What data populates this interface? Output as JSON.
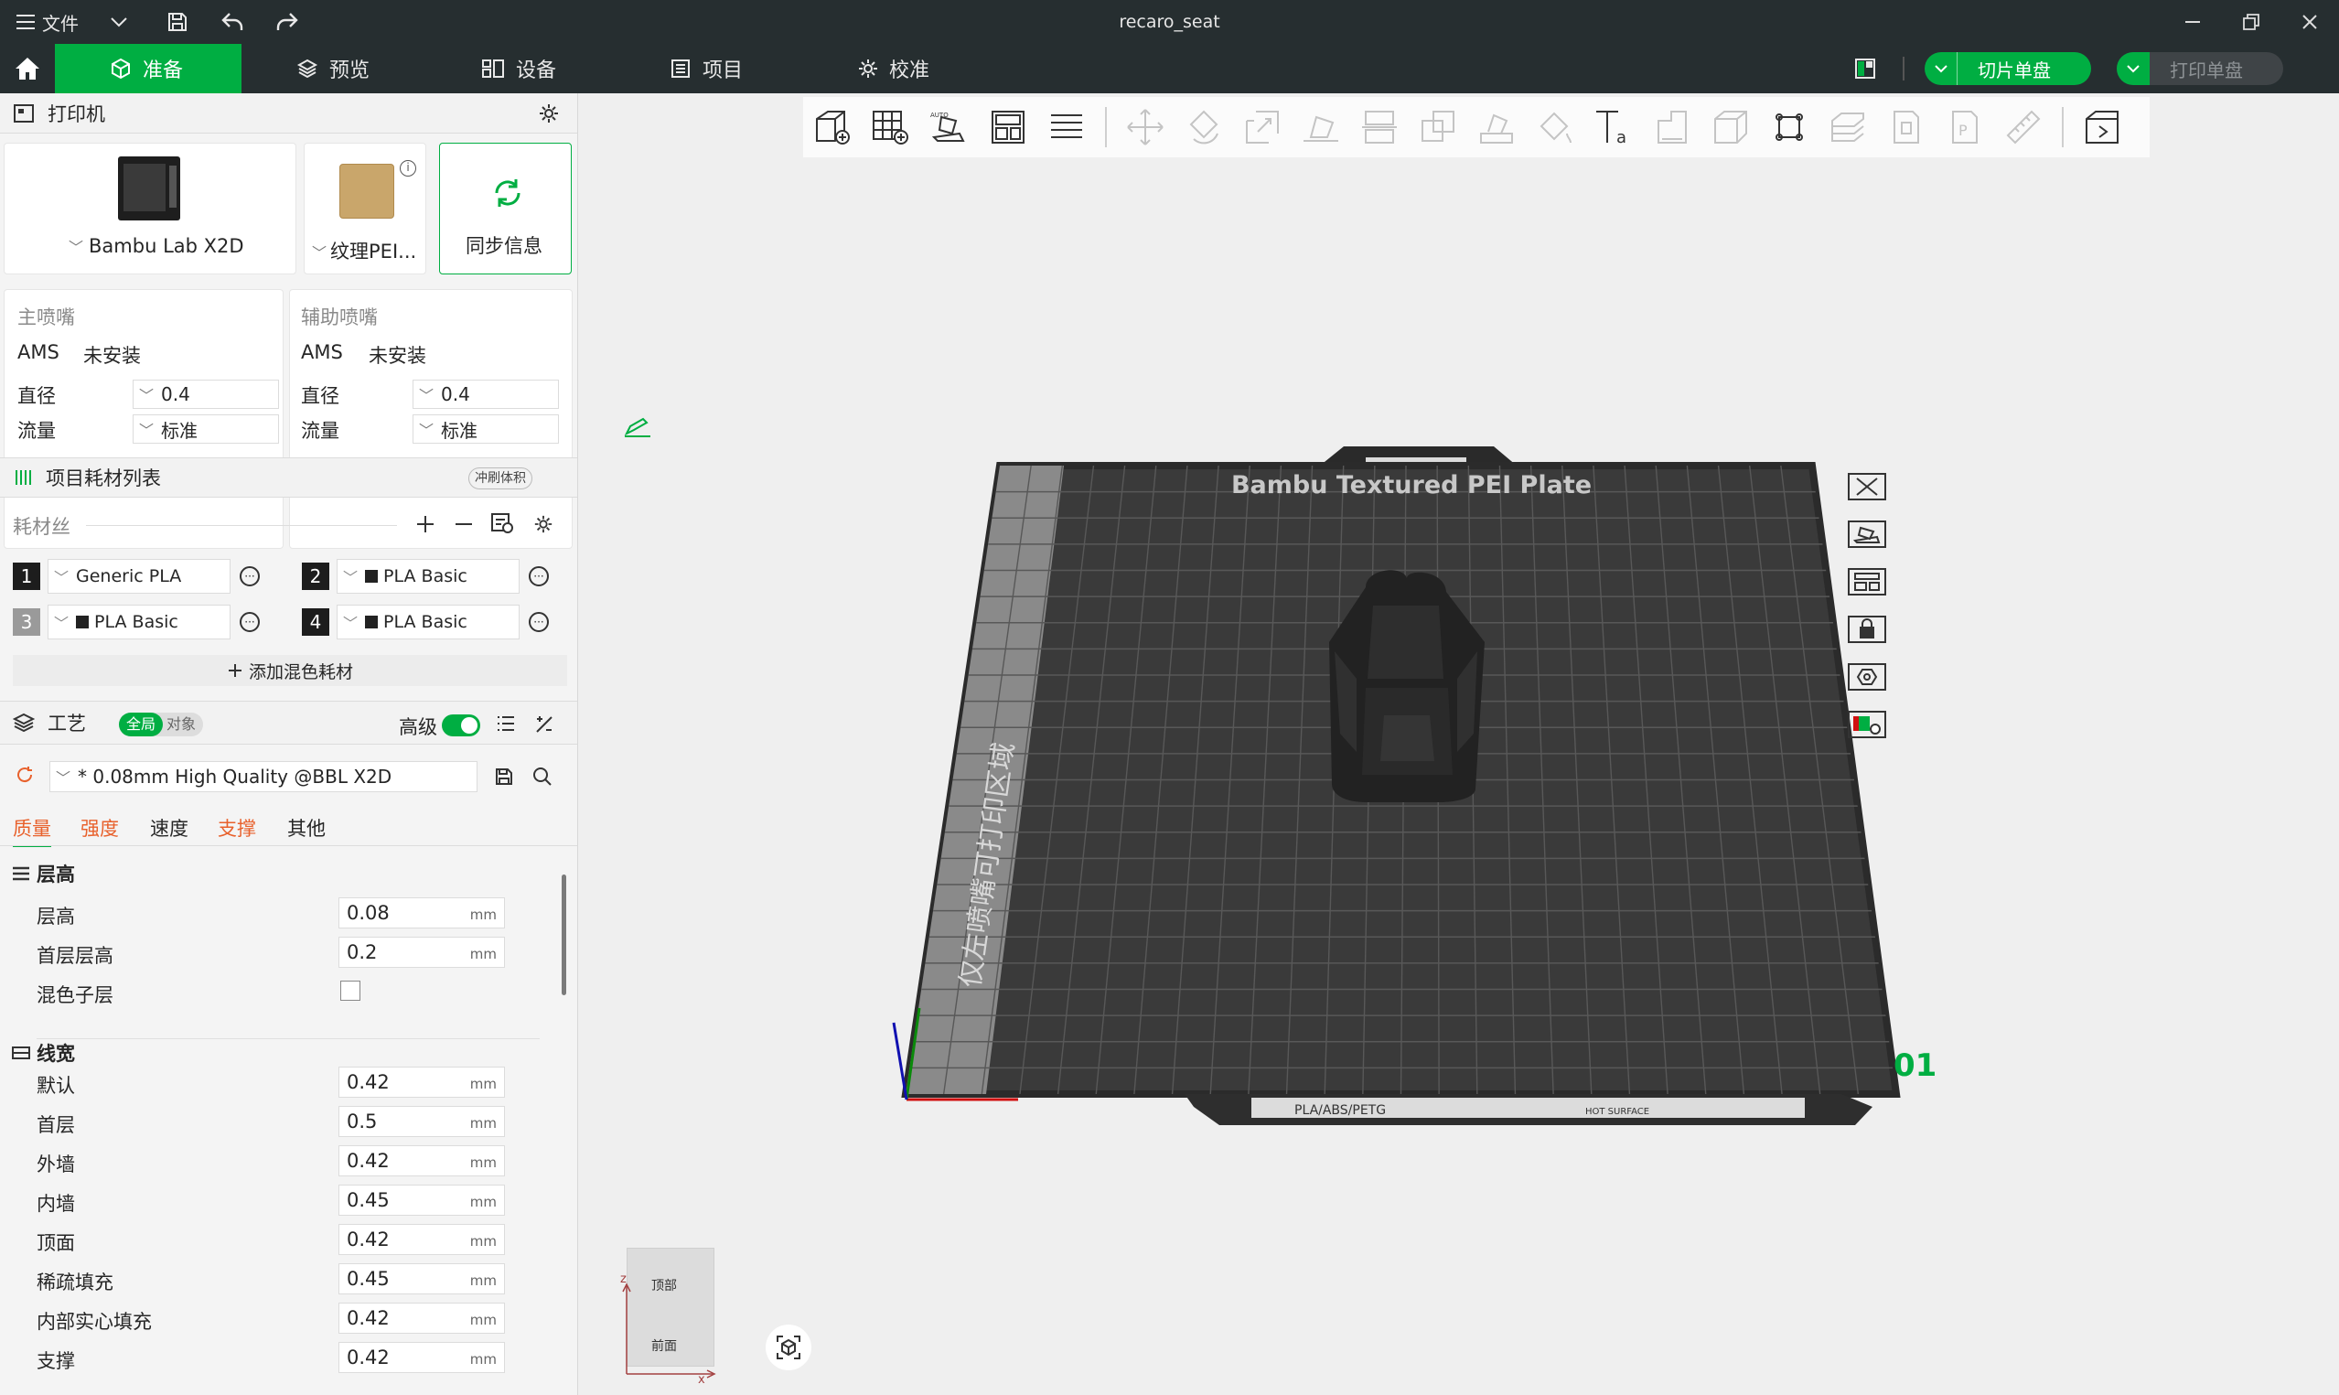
{
  "titlebar": {
    "menu_label": "文件",
    "window_title": "recaro_seat"
  },
  "tabs": [
    {
      "label": "准备",
      "icon": "cube-icon",
      "active": true
    },
    {
      "label": "预览",
      "icon": "layers-icon",
      "active": false
    },
    {
      "label": "设备",
      "icon": "device-icon",
      "active": false
    },
    {
      "label": "项目",
      "icon": "list-icon",
      "active": false
    },
    {
      "label": "校准",
      "icon": "calibrate-gear-icon",
      "active": false
    }
  ],
  "actions": {
    "slice_label": "切片单盘",
    "print_label": "打印单盘"
  },
  "printer_section": {
    "title": "打印机",
    "printer_name": "Bambu Lab X2D",
    "plate_name": "纹理PEI...",
    "sync_label": "同步信息",
    "main_nozzle": {
      "title": "主喷嘴",
      "ams_label": "AMS",
      "ams_value": "未安装",
      "diameter_label": "直径",
      "diameter_value": "0.4",
      "flow_label": "流量",
      "flow_value": "标准"
    },
    "aux_nozzle": {
      "title": "辅助喷嘴",
      "ams_label": "AMS",
      "ams_value": "未安装",
      "diameter_label": "直径",
      "diameter_value": "0.4",
      "flow_label": "流量",
      "flow_value": "标准"
    }
  },
  "filament_section": {
    "title": "项目耗材列表",
    "flush_label": "冲刷体积",
    "filament_label": "耗材丝",
    "filaments": [
      {
        "num": "1",
        "name": "Generic PLA",
        "swatch": false
      },
      {
        "num": "2",
        "name": "PLA Basic",
        "swatch": true
      },
      {
        "num": "3",
        "name": "PLA Basic",
        "swatch": true
      },
      {
        "num": "4",
        "name": "PLA Basic",
        "swatch": true
      }
    ],
    "add_mixed_label": "添加混色耗材"
  },
  "process_section": {
    "title": "工艺",
    "toggle_global": "全局",
    "toggle_object": "对象",
    "advanced_label": "高级",
    "profile": "* 0.08mm High Quality @BBL X2D",
    "subtabs": [
      {
        "label": "质量",
        "active": true,
        "modified": true
      },
      {
        "label": "强度",
        "active": false,
        "modified": true
      },
      {
        "label": "速度",
        "active": false,
        "modified": false
      },
      {
        "label": "支撑",
        "active": false,
        "modified": true
      },
      {
        "label": "其他",
        "active": false,
        "modified": false
      }
    ],
    "layer_height_group": "层高",
    "layer_params": [
      {
        "label": "层高",
        "value": "0.08",
        "unit": "mm"
      },
      {
        "label": "首层层高",
        "value": "0.2",
        "unit": "mm"
      }
    ],
    "mix_sublayer_label": "混色子层",
    "line_width_group": "线宽",
    "width_params": [
      {
        "label": "默认",
        "value": "0.42",
        "unit": "mm"
      },
      {
        "label": "首层",
        "value": "0.5",
        "unit": "mm"
      },
      {
        "label": "外墙",
        "value": "0.42",
        "unit": "mm"
      },
      {
        "label": "内墙",
        "value": "0.45",
        "unit": "mm"
      },
      {
        "label": "顶面",
        "value": "0.42",
        "unit": "mm"
      },
      {
        "label": "稀疏填充",
        "value": "0.45",
        "unit": "mm"
      },
      {
        "label": "内部实心填充",
        "value": "0.42",
        "unit": "mm"
      },
      {
        "label": "支撑",
        "value": "0.42",
        "unit": "mm"
      }
    ]
  },
  "scene": {
    "plate_title": "Bambu Textured PEI Plate",
    "left_zone_label": "仅左喷嘴可打印区域",
    "plate_number": "01",
    "plate_footer": "PLA/ABS/PETG",
    "hot_surface": "HOT SURFACE",
    "view_top": "顶部",
    "view_front": "前面",
    "axis_x": "x",
    "axis_z": "z"
  },
  "colors": {
    "accent": "#00ae42",
    "titlebar": "#262e30",
    "plate": "#3a3a3a",
    "modified": "#e8612c"
  }
}
